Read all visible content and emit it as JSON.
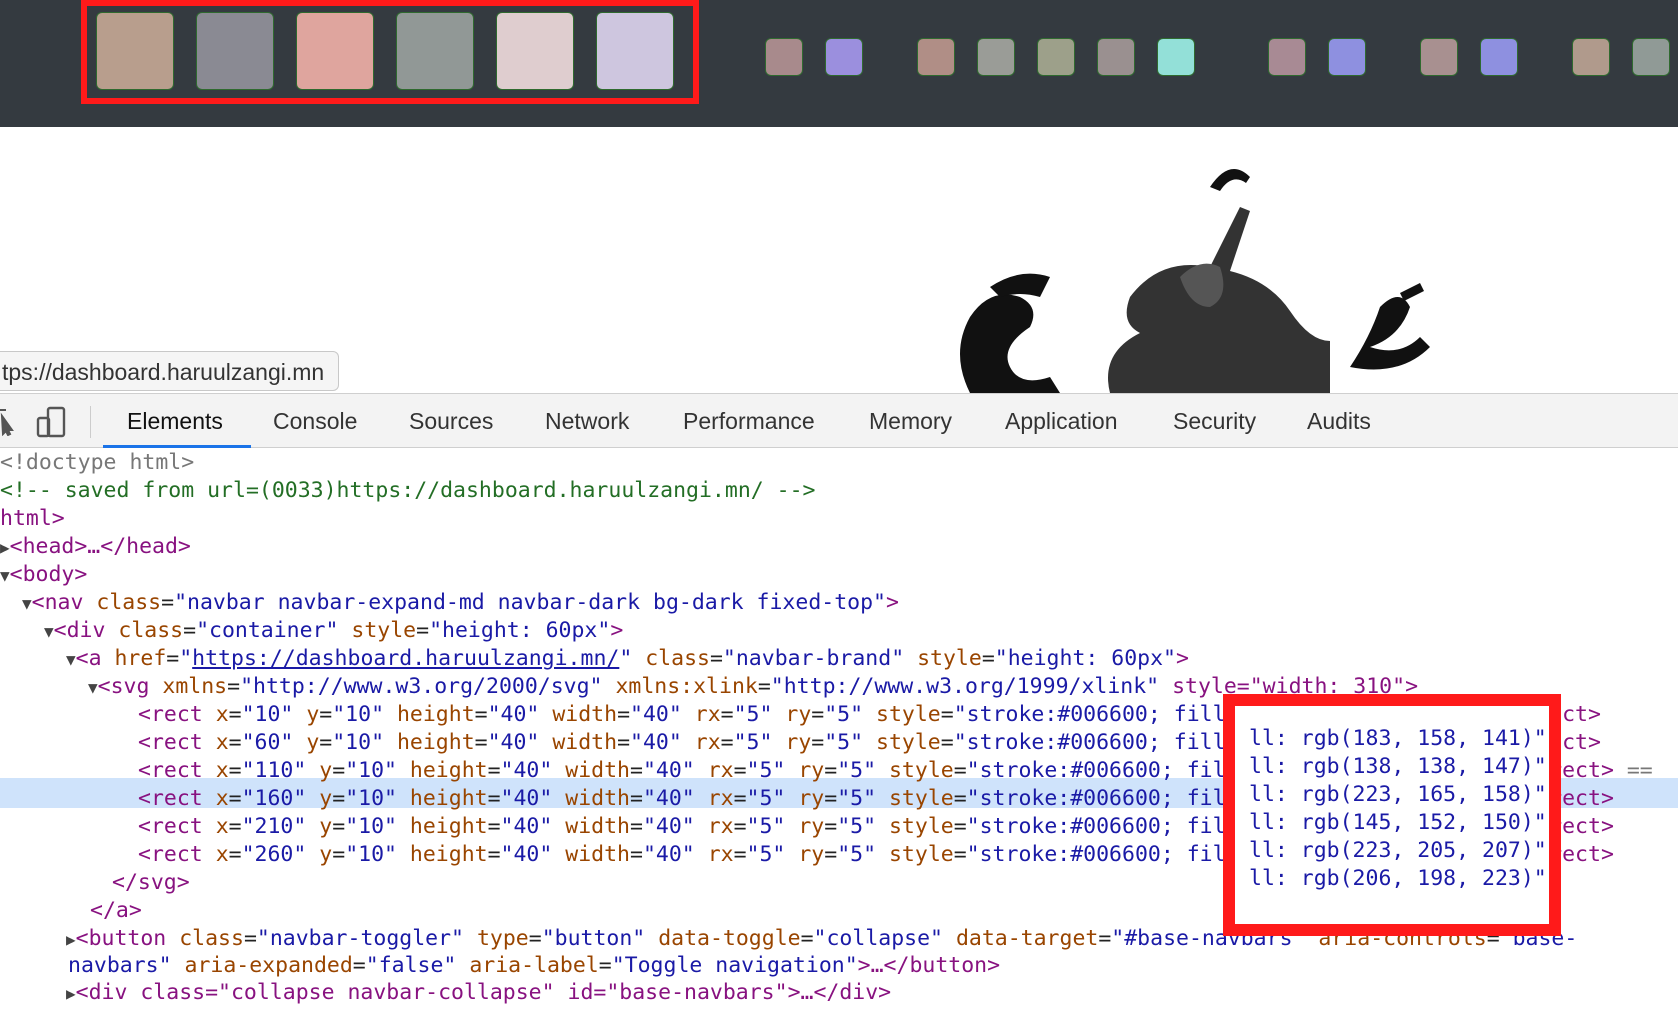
{
  "navbar": {
    "brand_colors": [
      "#b89e8d",
      "#8a8a93",
      "#dfa59e",
      "#919896",
      "#dfcdcf",
      "#cec6df"
    ],
    "small_colors": [
      "#a88a8c",
      "#9b8fde",
      "#b08e86",
      "#9a9c97",
      "#9da08a",
      "#9a9090",
      "#93e0d8",
      "#a88a94",
      "#8e90e0",
      "#a89090",
      "#8e90e0",
      "#b09a8c",
      "#909a96"
    ]
  },
  "status_url": "tps://dashboard.haruulzangi.mn",
  "devtools": {
    "tabs": [
      "Elements",
      "Console",
      "Sources",
      "Network",
      "Performance",
      "Memory",
      "Application",
      "Security",
      "Audits"
    ],
    "active_tab": "Elements"
  },
  "source": {
    "doctype": "<!doctype html>",
    "comment": "<!-- saved from url=(0033)https://dashboard.haruulzangi.mn/ -->",
    "html_open": "html>",
    "head": "<head>…</head>",
    "body_open": "<body>",
    "nav": {
      "tag": "<nav",
      "attr": "class",
      "val": "\"navbar navbar-expand-md navbar-dark bg-dark fixed-top\"",
      "close": ">"
    },
    "div": {
      "tag": "<div",
      "a1": "class",
      "v1": "\"container\"",
      "a2": "style",
      "v2": "\"height: 60px\"",
      "close": ">"
    },
    "a": {
      "tag": "<a",
      "a1": "href",
      "v1_pre": "\"",
      "v1_link": "https://dashboard.haruulzangi.mn/",
      "v1_post": "\"",
      "a2": "class",
      "v2": "\"navbar-brand\"",
      "a3": "style",
      "v3": "\"height: 60px\"",
      "close": ">"
    },
    "svg": {
      "tag": "<svg",
      "a1": "xmlns",
      "v1": "\"http://www.w3.org/2000/svg\"",
      "a2": "xmlns:xlink",
      "v2": "\"http://www.w3.org/1999/xlink\"",
      "tail": " style=\"width: 310\">"
    },
    "rects": [
      {
        "x": "\"10\"",
        "fill": "rgb(183, 158, 141)"
      },
      {
        "x": "\"60\"",
        "fill": "rgb(138, 138, 147)"
      },
      {
        "x": "\"110\"",
        "fill": "rgb(223, 165, 158)"
      },
      {
        "x": "\"160\"",
        "fill": "rgb(145, 152, 150)"
      },
      {
        "x": "\"210\"",
        "fill": "rgb(223, 205, 207)"
      },
      {
        "x": "\"260\"",
        "fill": "rgb(206, 198, 223)"
      }
    ],
    "rect_common": {
      "tag": "<rect",
      "x": "x",
      "y": "y",
      "yv": "\"10\"",
      "h": "height",
      "hv": "\"40\"",
      "w": "width",
      "wv": "\"40\"",
      "rx": "rx",
      "rxv": "\"5\"",
      "ry": "ry",
      "ryv": "\"5\"",
      "st": "style",
      "stroke": "\"stroke:#006600; fill: ",
      "end": "\">",
      "close": "</rect>"
    },
    "svg_close": "</svg>",
    "a_close": "</a>",
    "button": {
      "tag": "<button",
      "a1": "class",
      "v1": "\"navbar-toggler\"",
      "a2": "type",
      "v2": "\"button\"",
      "a3": "data-toggle",
      "v3": "\"collapse\"",
      "a4": "data-target",
      "v4": "\"#base-navbars\"",
      "a5": "aria-controls",
      "v5": "\"base-"
    },
    "button2": {
      "v5b": "navbars\"",
      "a6": "aria-expanded",
      "v6": "\"false\"",
      "a7": "aria-label",
      "v7": "\"Toggle navigation\"",
      "close": ">…</button>"
    },
    "div2": "<div class=\"collapse navbar-collapse\" id=\"base-navbars\">…</div>",
    "eq": "=="
  }
}
